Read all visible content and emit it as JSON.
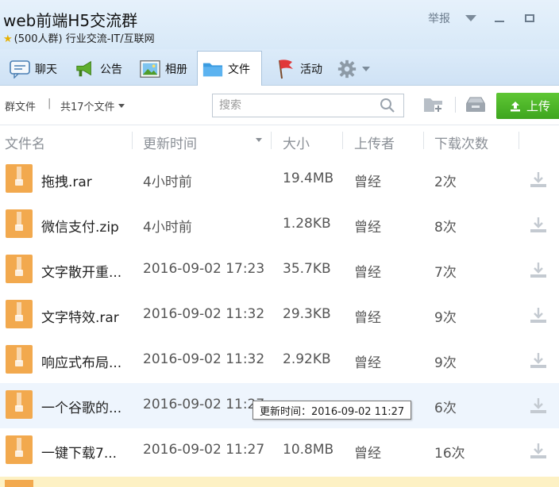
{
  "window": {
    "title": "web前端H5交流群",
    "member_count": "(500人群)",
    "category": "行业交流-IT/互联网",
    "report_label": "举报"
  },
  "tabs": [
    {
      "label": "聊天",
      "icon": "chat-icon"
    },
    {
      "label": "公告",
      "icon": "megaphone-icon"
    },
    {
      "label": "相册",
      "icon": "album-icon"
    },
    {
      "label": "文件",
      "icon": "folder-icon",
      "active": true
    },
    {
      "label": "活动",
      "icon": "flag-icon"
    },
    {
      "label": "",
      "icon": "gear-icon"
    }
  ],
  "toolbar": {
    "breadcrumb": "群文件",
    "separator": "|",
    "file_count": "共17个文件",
    "search_placeholder": "搜索",
    "upload_label": "上传"
  },
  "columns": {
    "name": "文件名",
    "updated": "更新时间",
    "size": "大小",
    "uploader": "上传者",
    "downloads": "下载次数"
  },
  "files": [
    {
      "name": "拖拽.rar",
      "updated": "4小时前",
      "size": "19.4MB",
      "uploader": "曾经",
      "downloads": "2次"
    },
    {
      "name": "微信支付.zip",
      "updated": "4小时前",
      "size": "1.28KB",
      "uploader": "曾经",
      "downloads": "8次"
    },
    {
      "name": "文字散开重...",
      "updated": "2016-09-02 17:23",
      "size": "35.7KB",
      "uploader": "曾经",
      "downloads": "7次"
    },
    {
      "name": "文字特效.rar",
      "updated": "2016-09-02 11:32",
      "size": "29.3KB",
      "uploader": "曾经",
      "downloads": "9次"
    },
    {
      "name": "响应式布局...",
      "updated": "2016-09-02 11:32",
      "size": "2.92KB",
      "uploader": "曾经",
      "downloads": "9次"
    },
    {
      "name": "一个谷歌的...",
      "updated": "2016-09-02 11:27",
      "size": "",
      "uploader": "",
      "downloads": "6次"
    },
    {
      "name": "一键下载7...",
      "updated": "2016-09-02 11:27",
      "size": "10.8MB",
      "uploader": "曾经",
      "downloads": "16次"
    }
  ],
  "tooltip": "更新时间：2016-09-02 11:27",
  "colors": {
    "accent_green": "#4cb52a",
    "archive_orange": "#f2a94e",
    "hover_row": "#eef5fd"
  }
}
